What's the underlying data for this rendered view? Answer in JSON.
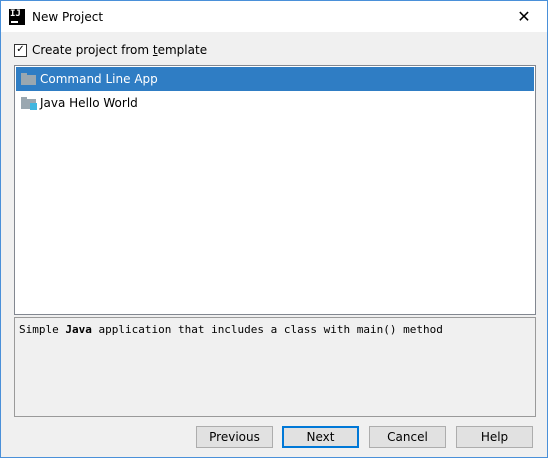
{
  "window": {
    "title": "New Project",
    "app_icon_text": "IJ",
    "close_glyph": "✕"
  },
  "template_checkbox": {
    "label_prefix": "Create project from ",
    "label_mnemonic": "t",
    "label_suffix": "emplate",
    "checked": true,
    "check_glyph": "✓"
  },
  "templates": {
    "items": [
      {
        "label": "Command Line App",
        "icon": "folder-icon",
        "selected": true
      },
      {
        "label": "Java Hello World",
        "icon": "java-folder-icon",
        "selected": false
      }
    ]
  },
  "description": {
    "prefix": "Simple ",
    "bold": "Java",
    "suffix": " application that includes a class with main() method"
  },
  "buttons": {
    "previous": "Previous",
    "next": "Next",
    "cancel": "Cancel",
    "help": "Help"
  },
  "colors": {
    "selection": "#2f7dc4",
    "window_border": "#4a90d9",
    "default_button_border": "#0078d7"
  }
}
